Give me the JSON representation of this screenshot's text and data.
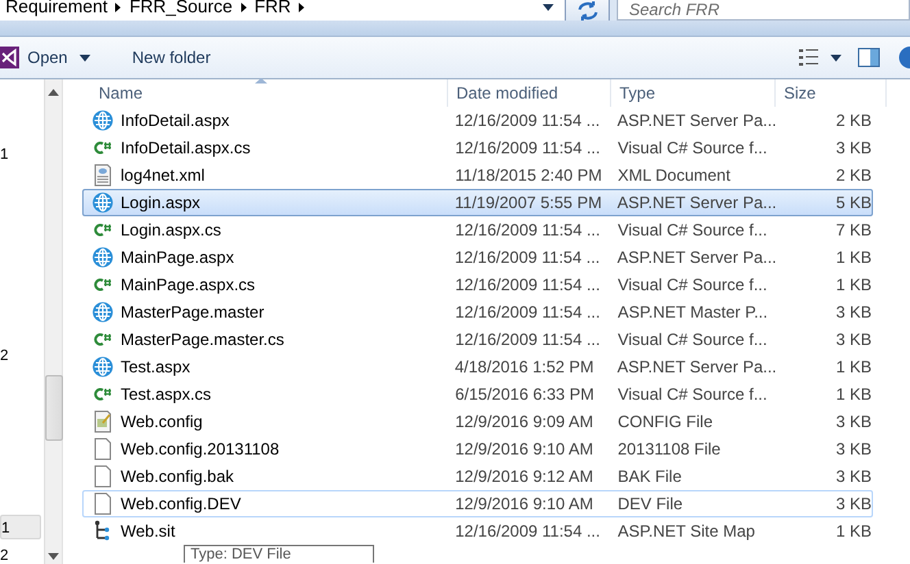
{
  "address_bar": {
    "breadcrumb": [
      "Requirement",
      "FRR_Source",
      "FRR"
    ]
  },
  "search": {
    "placeholder": "Search FRR"
  },
  "toolbar": {
    "open": "Open",
    "new_folder": "New folder"
  },
  "navigation": [
    {
      "label": "1",
      "selected": false
    },
    {
      "label": "2",
      "selected": false
    },
    {
      "label": "1",
      "selected": true
    },
    {
      "label": "2",
      "selected": false
    }
  ],
  "columns": [
    "Name",
    "Date modified",
    "Type",
    "Size"
  ],
  "rows": [
    {
      "kind": "web",
      "name": "InfoDetail.aspx",
      "date": "12/16/2009 11:54 ...",
      "type": "ASP.NET Server Pa...",
      "size": "2 KB",
      "selected": false,
      "hover": false
    },
    {
      "kind": "csharp",
      "name": "InfoDetail.aspx.cs",
      "date": "12/16/2009 11:54 ...",
      "type": "Visual C# Source f...",
      "size": "3 KB",
      "selected": false,
      "hover": false
    },
    {
      "kind": "xml",
      "name": "log4net.xml",
      "date": "11/18/2015 2:40 PM",
      "type": "XML Document",
      "size": "2 KB",
      "selected": false,
      "hover": false
    },
    {
      "kind": "web",
      "name": "Login.aspx",
      "date": "11/19/2007 5:55 PM",
      "type": "ASP.NET Server Pa...",
      "size": "5 KB",
      "selected": true,
      "hover": false
    },
    {
      "kind": "csharp",
      "name": "Login.aspx.cs",
      "date": "12/16/2009 11:54 ...",
      "type": "Visual C# Source f...",
      "size": "7 KB",
      "selected": false,
      "hover": false
    },
    {
      "kind": "web",
      "name": "MainPage.aspx",
      "date": "12/16/2009 11:54 ...",
      "type": "ASP.NET Server Pa...",
      "size": "1 KB",
      "selected": false,
      "hover": false
    },
    {
      "kind": "csharp",
      "name": "MainPage.aspx.cs",
      "date": "12/16/2009 11:54 ...",
      "type": "Visual C# Source f...",
      "size": "1 KB",
      "selected": false,
      "hover": false
    },
    {
      "kind": "web",
      "name": "MasterPage.master",
      "date": "12/16/2009 11:54 ...",
      "type": "ASP.NET Master P...",
      "size": "3 KB",
      "selected": false,
      "hover": false
    },
    {
      "kind": "csharp",
      "name": "MasterPage.master.cs",
      "date": "12/16/2009 11:54 ...",
      "type": "Visual C# Source f...",
      "size": "3 KB",
      "selected": false,
      "hover": false
    },
    {
      "kind": "web",
      "name": "Test.aspx",
      "date": "4/18/2016 1:52 PM",
      "type": "ASP.NET Server Pa...",
      "size": "1 KB",
      "selected": false,
      "hover": false
    },
    {
      "kind": "csharp",
      "name": "Test.aspx.cs",
      "date": "6/15/2016 6:33 PM",
      "type": "Visual C# Source f...",
      "size": "1 KB",
      "selected": false,
      "hover": false
    },
    {
      "kind": "config",
      "name": "Web.config",
      "date": "12/9/2016 9:09 AM",
      "type": "CONFIG File",
      "size": "3 KB",
      "selected": false,
      "hover": false
    },
    {
      "kind": "file",
      "name": "Web.config.20131108",
      "date": "12/9/2016 9:10 AM",
      "type": "20131108 File",
      "size": "3 KB",
      "selected": false,
      "hover": false
    },
    {
      "kind": "file",
      "name": "Web.config.bak",
      "date": "12/9/2016 9:12 AM",
      "type": "BAK File",
      "size": "3 KB",
      "selected": false,
      "hover": false
    },
    {
      "kind": "file",
      "name": "Web.config.DEV",
      "date": "12/9/2016 9:10 AM",
      "type": "DEV File",
      "size": "3 KB",
      "selected": false,
      "hover": true
    },
    {
      "kind": "sitemap",
      "name": "Web.sit",
      "date": "12/16/2009 11:54 ...",
      "type": "ASP.NET Site Map",
      "size": "1 KB",
      "selected": false,
      "hover": false
    }
  ],
  "tooltip": {
    "text": "Type: DEV File"
  }
}
